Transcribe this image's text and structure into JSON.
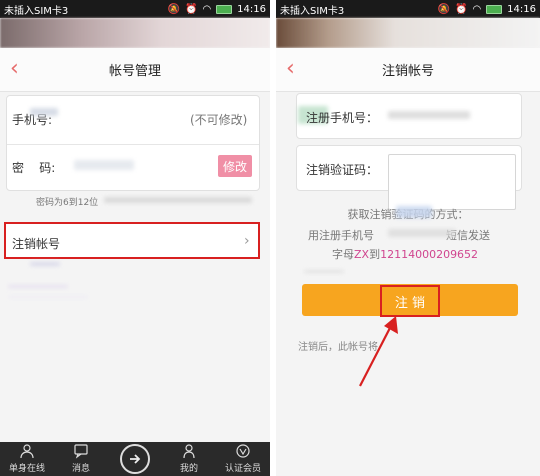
{
  "left": {
    "status": {
      "carrier": "未插入SIM卡3",
      "time": "14:16"
    },
    "nav": {
      "title": "帐号管理"
    },
    "phone_label": "手机号:",
    "phone_note": "(不可修改)",
    "password_label": "密    码:",
    "modify_button": "修改",
    "password_hint": "密码为6到12位",
    "cancel_account_item": "注销帐号",
    "tabs": [
      {
        "label": "单身在线",
        "icon": "person-icon"
      },
      {
        "label": "消息",
        "icon": "message-icon"
      },
      {
        "label": "",
        "icon": "arrow-right-circle-icon"
      },
      {
        "label": "我的",
        "icon": "user-icon"
      },
      {
        "label": "认证会员",
        "icon": "vip-icon"
      }
    ]
  },
  "right": {
    "status": {
      "carrier": "未插入SIM卡3",
      "time": "14:16"
    },
    "nav": {
      "title": "注销帐号"
    },
    "reg_phone_label": "注册手机号：",
    "verify_code_label": "注销验证码：",
    "instructions": {
      "line1": "获取注销验证码的方式：",
      "line2_prefix": "用注册手机号",
      "line2_suffix": "短信发送",
      "line3_prefix": "字母",
      "line3_code": "ZX",
      "line3_to": "到",
      "line3_number": "12114000209652"
    },
    "cancel_button": "注 销",
    "after_note": "注销后，此帐号将"
  },
  "colors": {
    "accent_red": "#e66a6a",
    "highlight": "#d82020",
    "orange": "#f7a51f",
    "pink": "#d0458f"
  }
}
